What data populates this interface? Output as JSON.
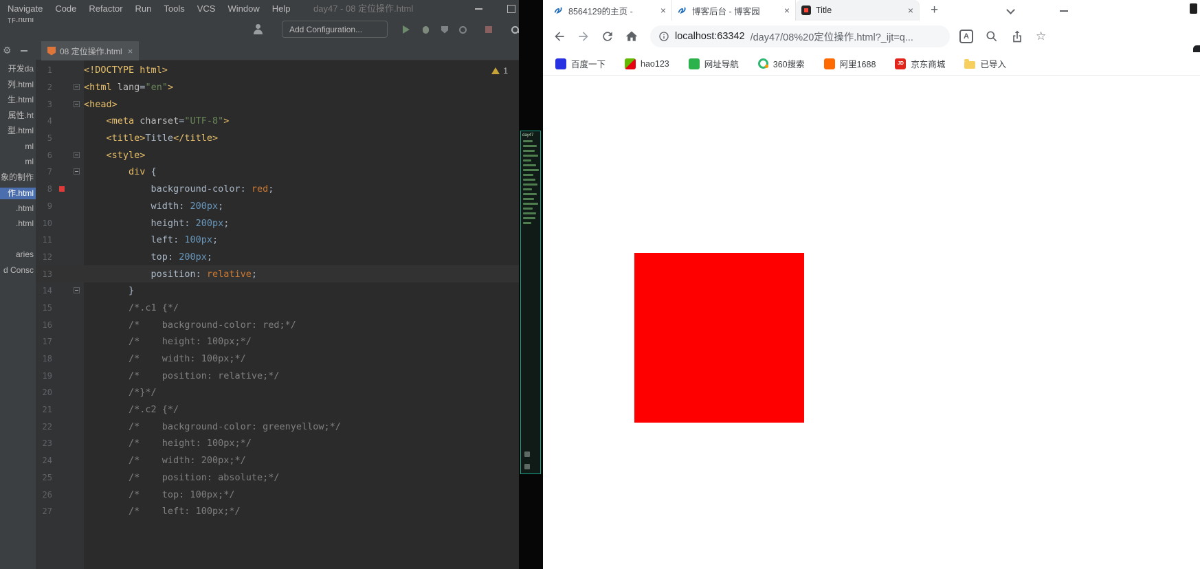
{
  "ide": {
    "menu": [
      "Navigate",
      "Code",
      "Refactor",
      "Run",
      "Tools",
      "VCS",
      "Window",
      "Help"
    ],
    "window_title": "day47 - 08 定位操作.html",
    "toolbar": {
      "add_configuration": "Add Configuration..."
    },
    "project_panel": {
      "items": [
        {
          "label": "作.html"
        },
        {
          "label": "开发da"
        },
        {
          "label": "列.html"
        },
        {
          "label": "生.html"
        },
        {
          "label": "属性.ht"
        },
        {
          "label": "型.html"
        },
        {
          "label": "ml"
        },
        {
          "label": "ml"
        },
        {
          "label": "象的制作"
        },
        {
          "label": "作.html",
          "selected": true
        },
        {
          "label": ".html"
        },
        {
          "label": ".html"
        },
        {
          "label": "aries"
        },
        {
          "label": "d Consc"
        }
      ]
    },
    "editor_tab": {
      "label": "08 定位操作.html"
    },
    "warnings": "1",
    "code": {
      "highlight_line": 13,
      "swatch_line": 8,
      "fold_lines": [
        2,
        3,
        6,
        7,
        14
      ],
      "lines": [
        {
          "n": 1,
          "tokens": [
            [
              "<!DOCTYPE html>",
              "tag"
            ]
          ]
        },
        {
          "n": 2,
          "tokens": [
            [
              "<html ",
              "tag"
            ],
            [
              "lang",
              "attr"
            ],
            [
              "=",
              "def"
            ],
            [
              "\"en\"",
              "str"
            ],
            [
              ">",
              "tag"
            ]
          ]
        },
        {
          "n": 3,
          "tokens": [
            [
              "<head>",
              "tag"
            ]
          ]
        },
        {
          "n": 4,
          "tokens": [
            [
              "    ",
              "def"
            ],
            [
              "<meta ",
              "tag"
            ],
            [
              "charset",
              "attr"
            ],
            [
              "=",
              "def"
            ],
            [
              "\"UTF-8\"",
              "str"
            ],
            [
              ">",
              "tag"
            ]
          ]
        },
        {
          "n": 5,
          "tokens": [
            [
              "    ",
              "def"
            ],
            [
              "<title>",
              "tag"
            ],
            [
              "Title",
              "txt"
            ],
            [
              "</title>",
              "tag"
            ]
          ]
        },
        {
          "n": 6,
          "tokens": [
            [
              "    ",
              "def"
            ],
            [
              "<style>",
              "tag"
            ]
          ]
        },
        {
          "n": 7,
          "tokens": [
            [
              "        ",
              "def"
            ],
            [
              "div",
              "sel"
            ],
            [
              " {",
              "def"
            ]
          ]
        },
        {
          "n": 8,
          "tokens": [
            [
              "            ",
              "def"
            ],
            [
              "background-color",
              "prop"
            ],
            [
              ": ",
              "def"
            ],
            [
              "red",
              "kw"
            ],
            [
              ";",
              "def"
            ]
          ]
        },
        {
          "n": 9,
          "tokens": [
            [
              "            ",
              "def"
            ],
            [
              "width",
              "prop"
            ],
            [
              ": ",
              "def"
            ],
            [
              "200px",
              "num"
            ],
            [
              ";",
              "def"
            ]
          ]
        },
        {
          "n": 10,
          "tokens": [
            [
              "            ",
              "def"
            ],
            [
              "height",
              "prop"
            ],
            [
              ": ",
              "def"
            ],
            [
              "200px",
              "num"
            ],
            [
              ";",
              "def"
            ]
          ]
        },
        {
          "n": 11,
          "tokens": [
            [
              "            ",
              "def"
            ],
            [
              "left",
              "prop"
            ],
            [
              ": ",
              "def"
            ],
            [
              "100px",
              "num"
            ],
            [
              ";",
              "def"
            ]
          ]
        },
        {
          "n": 12,
          "tokens": [
            [
              "            ",
              "def"
            ],
            [
              "top",
              "prop"
            ],
            [
              ": ",
              "def"
            ],
            [
              "200px",
              "num"
            ],
            [
              ";",
              "def"
            ]
          ]
        },
        {
          "n": 13,
          "tokens": [
            [
              "            ",
              "def"
            ],
            [
              "position",
              "prop"
            ],
            [
              ": ",
              "def"
            ],
            [
              "relative",
              "kw"
            ],
            [
              ";",
              "def"
            ]
          ]
        },
        {
          "n": 14,
          "tokens": [
            [
              "        }",
              "def"
            ]
          ]
        },
        {
          "n": 15,
          "tokens": [
            [
              "        ",
              "def"
            ],
            [
              "/*.c1 {*/",
              "cmt"
            ]
          ]
        },
        {
          "n": 16,
          "tokens": [
            [
              "        ",
              "def"
            ],
            [
              "/*    background-color: red;*/",
              "cmt"
            ]
          ]
        },
        {
          "n": 17,
          "tokens": [
            [
              "        ",
              "def"
            ],
            [
              "/*    height: 100px;*/",
              "cmt"
            ]
          ]
        },
        {
          "n": 18,
          "tokens": [
            [
              "        ",
              "def"
            ],
            [
              "/*    width: 100px;*/",
              "cmt"
            ]
          ]
        },
        {
          "n": 19,
          "tokens": [
            [
              "        ",
              "def"
            ],
            [
              "/*    position: relative;*/",
              "cmt"
            ]
          ]
        },
        {
          "n": 20,
          "tokens": [
            [
              "        ",
              "def"
            ],
            [
              "/*}*/",
              "cmt"
            ]
          ]
        },
        {
          "n": 21,
          "tokens": [
            [
              "        ",
              "def"
            ],
            [
              "/*.c2 {*/",
              "cmt"
            ]
          ]
        },
        {
          "n": 22,
          "tokens": [
            [
              "        ",
              "def"
            ],
            [
              "/*    background-color: greenyellow;*/",
              "cmt"
            ]
          ]
        },
        {
          "n": 23,
          "tokens": [
            [
              "        ",
              "def"
            ],
            [
              "/*    height: 100px;*/",
              "cmt"
            ]
          ]
        },
        {
          "n": 24,
          "tokens": [
            [
              "        ",
              "def"
            ],
            [
              "/*    width: 200px;*/",
              "cmt"
            ]
          ]
        },
        {
          "n": 25,
          "tokens": [
            [
              "        ",
              "def"
            ],
            [
              "/*    position: absolute;*/",
              "cmt"
            ]
          ]
        },
        {
          "n": 26,
          "tokens": [
            [
              "        ",
              "def"
            ],
            [
              "/*    top: 100px;*/",
              "cmt"
            ]
          ]
        },
        {
          "n": 27,
          "tokens": [
            [
              "        ",
              "def"
            ],
            [
              "/*    left: 100px;*/",
              "cmt"
            ]
          ]
        }
      ]
    }
  },
  "preview": {
    "label": "day47"
  },
  "browser": {
    "tabs": [
      {
        "title": "8564129的主页 -",
        "favicon": "cnblogs",
        "active": false
      },
      {
        "title": "博客后台 - 博客园",
        "favicon": "cnblogs",
        "active": false
      },
      {
        "title": "Title",
        "favicon": "localhost",
        "active": true
      }
    ],
    "address_host": "localhost:63342",
    "address_path": "/day47/08%20定位操作.html?_ijt=q...",
    "bookmarks": [
      {
        "id": "baidu",
        "label": "百度一下",
        "type": "square",
        "color": "#2932e1"
      },
      {
        "id": "hao123",
        "label": "hao123",
        "type": "split",
        "colors": [
          "#62b900",
          "#e60012"
        ]
      },
      {
        "id": "wangzhi-daohang",
        "label": "网址导航",
        "type": "square",
        "color": "#2bb24c"
      },
      {
        "id": "so360",
        "label": "360搜索",
        "type": "ring",
        "color": "#2eb872",
        "dot": "#ff9500"
      },
      {
        "id": "ali1688",
        "label": "阿里1688",
        "type": "square",
        "color": "#ff6a00"
      },
      {
        "id": "jd",
        "label": "京东商城",
        "type": "square",
        "color": "#e1251b",
        "glyph": "JD"
      },
      {
        "id": "imported",
        "label": "已导入",
        "type": "folder",
        "color": "#f7cf5f"
      }
    ],
    "content": {
      "square_color": "#fe0000"
    }
  }
}
